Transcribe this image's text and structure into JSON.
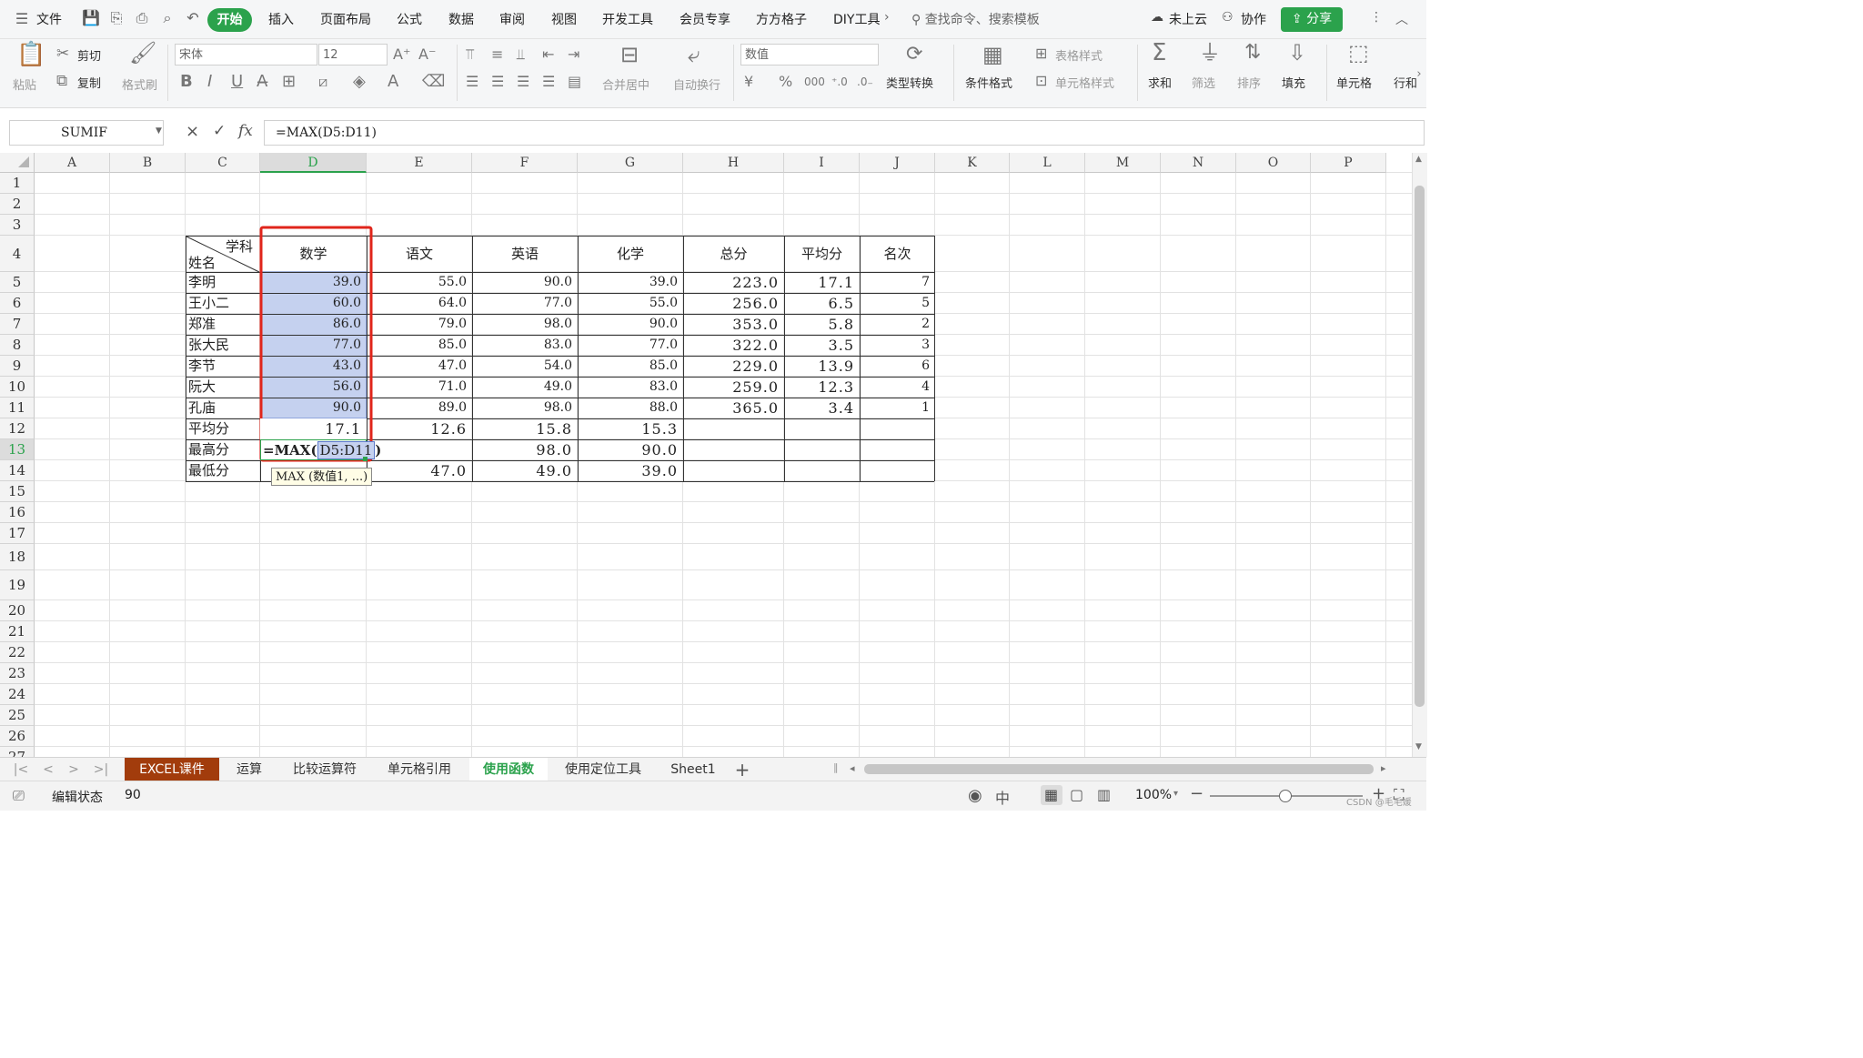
{
  "menu": {
    "file_label": "文件",
    "tabs": [
      "开始",
      "插入",
      "页面布局",
      "公式",
      "数据",
      "审阅",
      "视图",
      "开发工具",
      "会员专享",
      "方方格子",
      "DIY工具"
    ],
    "search_placeholder": "查找命令、搜索模板",
    "cloud_label": "未上云",
    "collab_label": "协作",
    "share_label": "分享"
  },
  "ribbon": {
    "paste_label": "粘贴",
    "cut_label": "剪切",
    "copy_label": "复制",
    "format_painter_label": "格式刷",
    "font_name": "宋体",
    "font_size": "12",
    "merge_center_label": "合并居中",
    "wrap_text_label": "自动换行",
    "number_format": "数值",
    "type_convert_label": "类型转换",
    "cond_format_label": "条件格式",
    "table_style_label": "表格样式",
    "cell_style_label": "单元格样式",
    "sum_label": "求和",
    "filter_label": "筛选",
    "sort_label": "排序",
    "fill_label": "填充",
    "cell_label": "单元格",
    "row_col_label": "行和"
  },
  "formula_bar": {
    "name_box": "SUMIF",
    "cancel_symbol": "×",
    "confirm_symbol": "✓",
    "fx_symbol": "fx",
    "formula": "=MAX(D5:D11)"
  },
  "sheet": {
    "columns": [
      "A",
      "B",
      "C",
      "D",
      "E",
      "F",
      "G",
      "H",
      "I",
      "J",
      "K",
      "L",
      "M",
      "N",
      "O",
      "P"
    ],
    "rows": [
      "1",
      "2",
      "3",
      "4",
      "5",
      "6",
      "7",
      "8",
      "9",
      "10",
      "11",
      "12",
      "13",
      "14",
      "15",
      "16",
      "17",
      "18",
      "19",
      "20",
      "21",
      "22",
      "23",
      "24",
      "25",
      "26",
      "27"
    ],
    "header_top": "学科",
    "header_bottom": "姓名",
    "subject_headers": [
      "数学",
      "语文",
      "英语",
      "化学",
      "总分",
      "平均分",
      "名次"
    ],
    "students": [
      {
        "name": "李明",
        "math": "39.0",
        "chinese": "55.0",
        "english": "90.0",
        "chem": "39.0",
        "total": "223.0",
        "avg": "17.1",
        "rank": "7"
      },
      {
        "name": "王小二",
        "math": "60.0",
        "chinese": "64.0",
        "english": "77.0",
        "chem": "55.0",
        "total": "256.0",
        "avg": "6.5",
        "rank": "5"
      },
      {
        "name": "郑准",
        "math": "86.0",
        "chinese": "79.0",
        "english": "98.0",
        "chem": "90.0",
        "total": "353.0",
        "avg": "5.8",
        "rank": "2"
      },
      {
        "name": "张大民",
        "math": "77.0",
        "chinese": "85.0",
        "english": "83.0",
        "chem": "77.0",
        "total": "322.0",
        "avg": "3.5",
        "rank": "3"
      },
      {
        "name": "李节",
        "math": "43.0",
        "chinese": "47.0",
        "english": "54.0",
        "chem": "85.0",
        "total": "229.0",
        "avg": "13.9",
        "rank": "6"
      },
      {
        "name": "阮大",
        "math": "56.0",
        "chinese": "71.0",
        "english": "49.0",
        "chem": "83.0",
        "total": "259.0",
        "avg": "12.3",
        "rank": "4"
      },
      {
        "name": "孔庙",
        "math": "90.0",
        "chinese": "89.0",
        "english": "98.0",
        "chem": "88.0",
        "total": "365.0",
        "avg": "3.4",
        "rank": "1"
      }
    ],
    "avg_row": {
      "label": "平均分",
      "math": "17.1",
      "chinese": "12.6",
      "english": "15.8",
      "chem": "15.3"
    },
    "max_row": {
      "label": "最高分",
      "formula_prefix": "=MAX(",
      "formula_ref": "D5:D11",
      "formula_suffix": ")",
      "english": "98.0",
      "chem": "90.0"
    },
    "min_row": {
      "label": "最低分",
      "chinese": "47.0",
      "english": "49.0",
      "chem": "39.0"
    },
    "tooltip": "MAX (数值1, ...)"
  },
  "tabs": {
    "sheets": [
      "EXCEL课件",
      "运算",
      "比较运算符",
      "单元格引用",
      "使用函数",
      "使用定位工具",
      "Sheet1"
    ],
    "active": "使用函数",
    "add_symbol": "+"
  },
  "status": {
    "mode": "编辑状态",
    "value": "90",
    "zoom": "100%",
    "watermark": "CSDN @毛毛媛"
  },
  "colors": {
    "accent_green": "#2ba24c",
    "selection_fill": "#c5d1ef",
    "red_outline": "#e0251b",
    "first_tab_bg": "#a23c0c"
  }
}
